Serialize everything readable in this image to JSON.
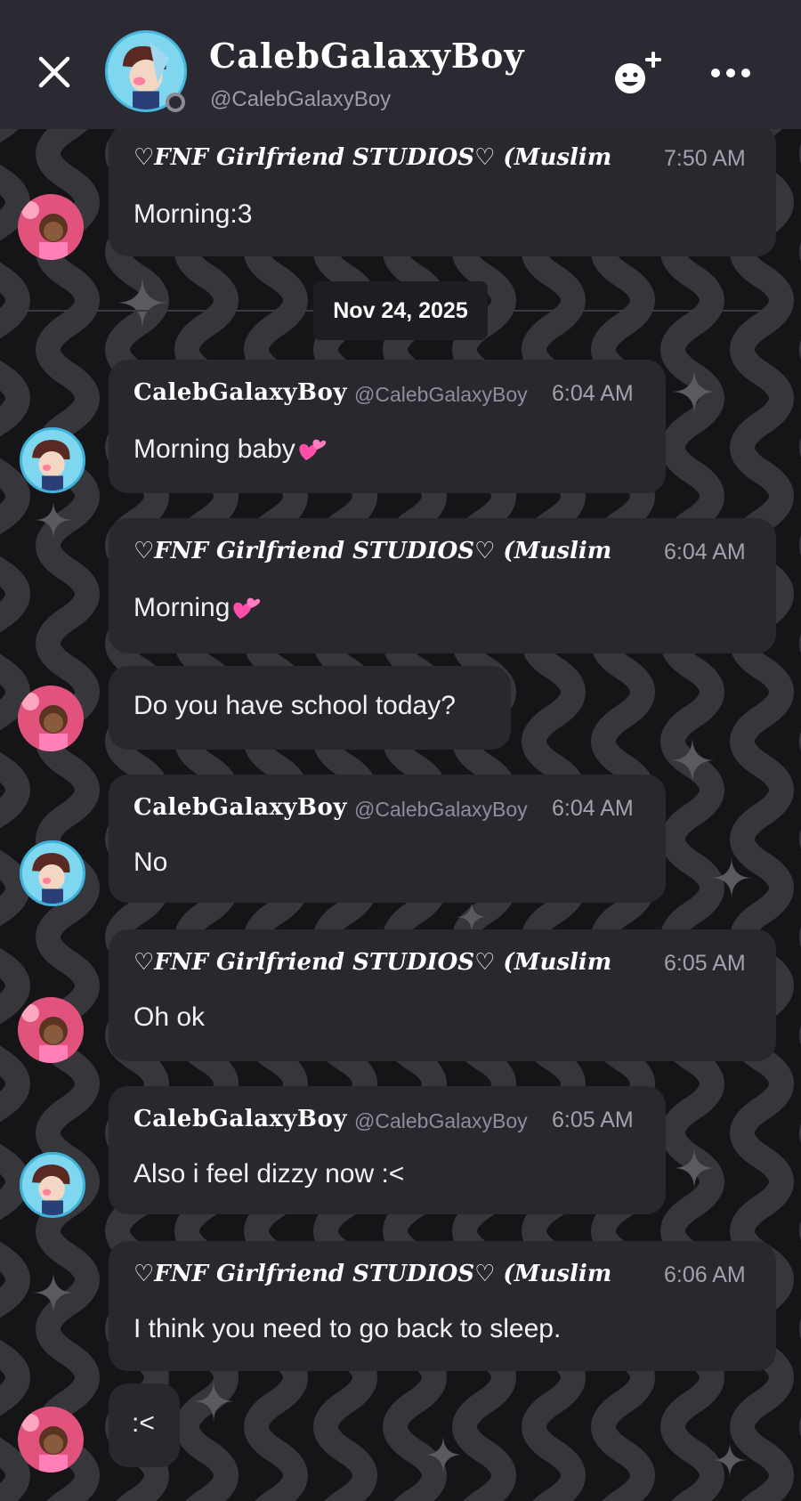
{
  "header": {
    "title": "CalebGalaxyBoy",
    "handle": "@CalebGalaxyBoy"
  },
  "date_divider": "Nov 24, 2025",
  "messages": [
    {
      "author": "♡FNF Girlfriend STUDIOS♡ (Muslim",
      "handle": "",
      "time": "7:50 AM",
      "text": "Morning:3"
    },
    {
      "author": "CalebGalaxyBoy",
      "handle": "@CalebGalaxyBoy",
      "time": "6:04 AM",
      "text": "Morning baby"
    },
    {
      "author": "♡FNF Girlfriend STUDIOS♡ (Muslim",
      "handle": "",
      "time": "6:04 AM",
      "text": "Morning"
    },
    {
      "author": "",
      "handle": "",
      "time": "",
      "text": "Do you have school today?"
    },
    {
      "author": "CalebGalaxyBoy",
      "handle": "@CalebGalaxyBoy",
      "time": "6:04 AM",
      "text": "No"
    },
    {
      "author": "♡FNF Girlfriend STUDIOS♡ (Muslim",
      "handle": "",
      "time": "6:05 AM",
      "text": "Oh ok"
    },
    {
      "author": "CalebGalaxyBoy",
      "handle": "@CalebGalaxyBoy",
      "time": "6:05 AM",
      "text": "Also i feel dizzy now :<"
    },
    {
      "author": "♡FNF Girlfriend STUDIOS♡ (Muslim",
      "handle": "",
      "time": "6:06 AM",
      "text": "I think you need to go back to sleep."
    },
    {
      "author": "",
      "handle": "",
      "time": "",
      "text": ":<"
    }
  ],
  "icons": {
    "close": "close-icon",
    "add_user": "add-user-icon",
    "more": "more-icon",
    "hearts_emoji": "two-hearts-emoji"
  },
  "colors": {
    "header_bg": "#2b2a33",
    "bubble_bg": "#29282f",
    "background": "#151517",
    "heart_pink": "#ff4fa8"
  }
}
